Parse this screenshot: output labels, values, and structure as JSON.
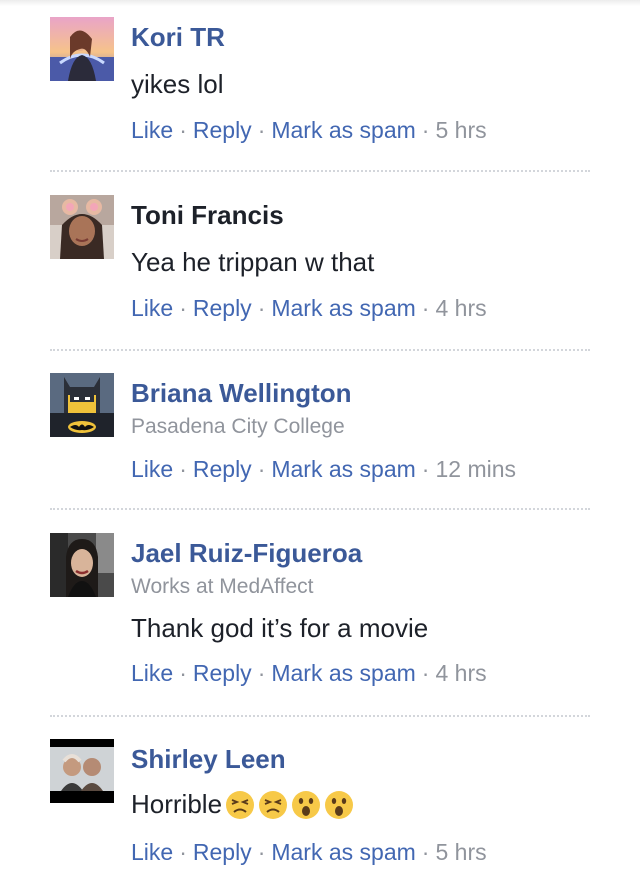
{
  "actions": {
    "like": "Like",
    "reply": "Reply",
    "spam": "Mark as spam",
    "separator": "·"
  },
  "comments": [
    {
      "name": "Kori TR",
      "text": "yikes lol",
      "time": "5 hrs",
      "avatar_icon": "profile-photo-woman-sunset"
    },
    {
      "name": "Toni Francis",
      "text": "Yea he trippan w that",
      "time": "4 hrs",
      "avatar_icon": "profile-photo-woman-bear-ears"
    },
    {
      "name": "Briana Wellington",
      "subtitle": "Pasadena City College",
      "time": "12 mins",
      "avatar_icon": "profile-photo-lego-batman"
    },
    {
      "name": "Jael Ruiz-Figueroa",
      "subtitle": "Works at MedAffect",
      "text": "Thank god it’s for a movie",
      "time": "4 hrs",
      "avatar_icon": "profile-photo-woman-car"
    },
    {
      "name": "Shirley Leen",
      "text": "Horrible",
      "time": "5 hrs",
      "avatar_icon": "profile-photo-couple",
      "emojis": [
        "persevering-face-emoji",
        "persevering-face-emoji",
        "astonished-face-emoji",
        "astonished-face-emoji"
      ]
    }
  ],
  "colors": {
    "link": "#4267b2",
    "name": "#3b5998",
    "meta": "#90949c",
    "text": "#1d2129"
  }
}
